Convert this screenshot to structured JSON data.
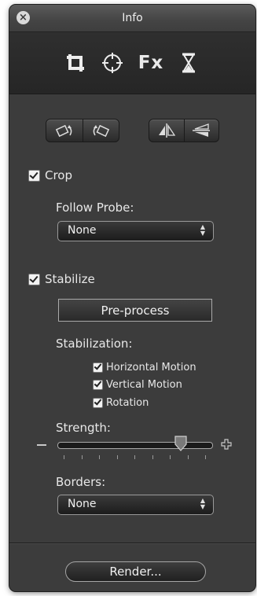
{
  "window": {
    "title": "Info"
  },
  "modes": {
    "fx_label": "Fx",
    "items": [
      {
        "icon": "crop-icon"
      },
      {
        "icon": "target-icon"
      },
      {
        "icon": "fx-icon"
      },
      {
        "icon": "hourglass-icon"
      }
    ]
  },
  "transform": {
    "rotate": [
      {
        "icon": "rotate-clockwise-icon"
      },
      {
        "icon": "rotate-counterclockwise-icon"
      }
    ],
    "flip": [
      {
        "icon": "flip-horizontal-icon"
      },
      {
        "icon": "flip-vertical-icon"
      }
    ]
  },
  "crop": {
    "label": "Crop",
    "checked": true,
    "follow_probe_label": "Follow Probe:",
    "follow_probe_value": "None"
  },
  "stabilize": {
    "label": "Stabilize",
    "checked": true,
    "preprocess_label": "Pre-process",
    "stabilization_label": "Stabilization:",
    "options": [
      {
        "label": "Horizontal Motion",
        "checked": true
      },
      {
        "label": "Vertical Motion",
        "checked": true
      },
      {
        "label": "Rotation",
        "checked": true
      }
    ],
    "strength_label": "Strength:",
    "strength_level": 0.8,
    "borders_label": "Borders:",
    "borders_value": "None"
  },
  "footer": {
    "render_label": "Render..."
  },
  "colors": {
    "panel": "#3c3c3c",
    "modebar": "#2a2a2a",
    "text": "#e8e8e8"
  }
}
